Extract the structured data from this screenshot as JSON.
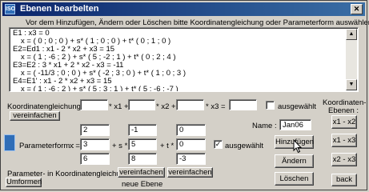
{
  "window": {
    "title": "Ebenen bearbelten",
    "app_icon": "iso-icon"
  },
  "instruction": "Vor dem Hinzufügen, Ändern oder Löschen bitte Koordinatengleichung oder Parameterform auswählen !",
  "equations": [
    "E1 : x3 = 0",
    "x = ( 0 ; 0 ; 0 ) + s* ( 1 ; 0 ; 0 ) + t* ( 0 ; 1 ; 0 )",
    "E2=Ed1 : x1  - 2 * x2 + x3 = 15",
    "x = ( 1 ; -6 ; 2 ) + s* ( 5 ; -2 ; 1 ) + t* ( 0 ; 2 ; 4 )",
    "E3=E2 : 3 * x1 + 2 * x2  - x3 = -11",
    "x = ( -11/3 ; 0 ; 0 ) + s* ( -2 ; 3 ; 0 ) + t* ( 1 ; 0 ; 3 )",
    "E4=E1' : x1  - 2 * x2 + x3 = 15",
    "x = ( 1 ; -6 ; 2 ) + s* ( 5 ; 3 ; 1 ) + t* ( 5 ; -6 ; -7 )"
  ],
  "coord": {
    "label": "Koordinatengleichung :",
    "x1_label": "* x1 +",
    "x2_label": "* x2 +",
    "x3_label": "* x3 =",
    "values": [
      "",
      "",
      "",
      ""
    ],
    "simplify_label": "vereinfachen",
    "selected_label": "ausgewählt",
    "selected": false
  },
  "koord_ebenen": {
    "label_line1": "Koordinaten-",
    "label_line2": "Ebenen :",
    "buttons": [
      "x1 - x2",
      "x1 - x3",
      "x2 - x3"
    ]
  },
  "name": {
    "label": "Name :",
    "value": "Jan06"
  },
  "param": {
    "label": "Parameterform :",
    "x_label": "x =",
    "s_label": "+ s *",
    "t_label": "+ t *",
    "position": [
      "2",
      "3",
      "6"
    ],
    "dir1": [
      "-1",
      "5",
      "8"
    ],
    "dir2": [
      "0",
      "0",
      "-3"
    ],
    "selected_label": "ausgewählt",
    "selected": true
  },
  "actions": {
    "add": "Hinzufügen",
    "change": "Ändern",
    "delete": "Löschen",
    "back": "back"
  },
  "convert": {
    "label": "Parameter- in Koordinatengleichung",
    "button": "Umformen",
    "simplify1": "vereinfachen",
    "simplify2": "vereinfachen",
    "new_plane": "neue Ebene"
  }
}
